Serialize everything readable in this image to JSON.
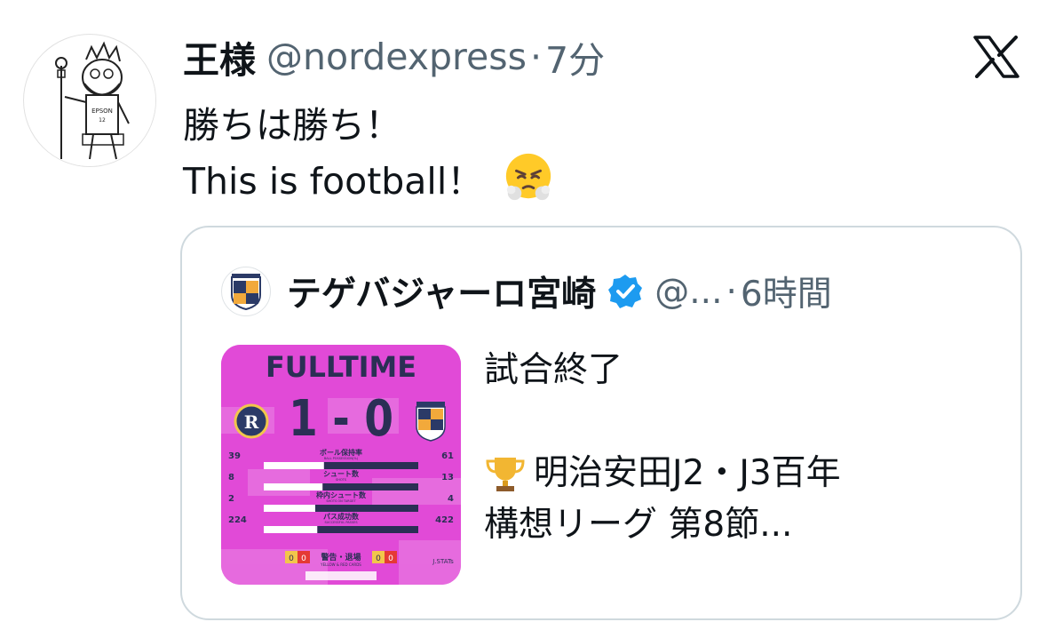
{
  "tweet": {
    "display_name": "王様",
    "handle": "@nordexpress",
    "separator": "·",
    "time": "7分",
    "line1": "勝ちは勝ち！",
    "line2": "This is football！",
    "emoji": "face-with-steam-from-nose-emoji",
    "avatar_text": "EPSON"
  },
  "quote": {
    "display_name": "テゲバジャーロ宮崎",
    "handle": "@...",
    "separator": "·",
    "time": "6時間",
    "text_line1": "試合終了",
    "text_line3": "明治安田J2・J3百年",
    "text_line4": "構想リーグ 第8節...",
    "trophy_icon": "trophy-emoji",
    "verified_color": "#1d9bf0"
  },
  "media": {
    "title": "FULLTIME",
    "score": "1 - 0",
    "home_badge": "R",
    "stats": [
      {
        "label": "ボール保持率",
        "sub": "BALL POSSESSION(%)",
        "home": "39",
        "away": "61"
      },
      {
        "label": "シュート数",
        "sub": "SHOTS",
        "home": "8",
        "away": "13"
      },
      {
        "label": "枠内シュート数",
        "sub": "SHOTS ON TARGET",
        "home": "2",
        "away": "4"
      },
      {
        "label": "パス成功数",
        "sub": "SUCCESSFUL PASSES",
        "home": "224",
        "away": "422"
      }
    ],
    "cards_label": "警告・退場",
    "cards_sub": "YELLOW & RED CARDS",
    "home_cards": [
      "0",
      "0"
    ],
    "away_cards": [
      "0",
      "0"
    ],
    "brand": "J.STATs",
    "background_color": "#e14ad7"
  },
  "colors": {
    "text_primary": "#0f1419",
    "text_secondary": "#536471",
    "border": "#cfd9de"
  }
}
